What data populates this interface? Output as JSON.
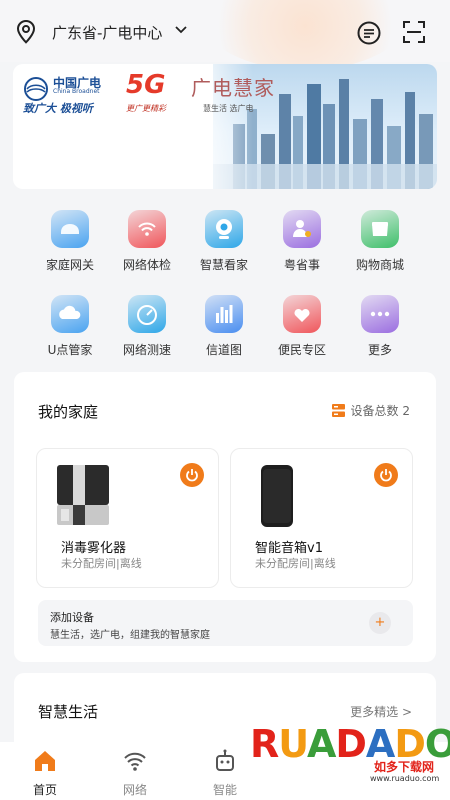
{
  "header": {
    "location": "广东省-广电中心",
    "icons": [
      "location-pin-icon",
      "chevron-down-icon",
      "message-icon",
      "scan-icon"
    ]
  },
  "banner": {
    "brand1_title": "中国广电",
    "brand1_sub": "China Broadnet",
    "brand1_slogan": "致广大 极视听",
    "brand2": "5G",
    "brand2_sub": "更广更精彩",
    "brand3": "广电慧家",
    "brand3_sub": "慧生活 选广电"
  },
  "services": [
    {
      "label": "家庭网关",
      "icon": "home-gateway-icon",
      "color": "#4aa3f0"
    },
    {
      "label": "网络体检",
      "icon": "network-check-icon",
      "color": "#f0565b"
    },
    {
      "label": "智慧看家",
      "icon": "camera-icon",
      "color": "#2fa7e8"
    },
    {
      "label": "粤省事",
      "icon": "person-icon",
      "color": "#9b6ee0"
    },
    {
      "label": "购物商城",
      "icon": "shop-icon",
      "color": "#3fbf6a"
    },
    {
      "label": "U点管家",
      "icon": "cloud-icon",
      "color": "#4aa3f0"
    },
    {
      "label": "网络测速",
      "icon": "speedometer-icon",
      "color": "#2fa7e8"
    },
    {
      "label": "信道图",
      "icon": "bar-chart-icon",
      "color": "#4a8ef0"
    },
    {
      "label": "便民专区",
      "icon": "heart-hand-icon",
      "color": "#f0565b"
    },
    {
      "label": "更多",
      "icon": "more-icon",
      "color": "#9b6ee0"
    }
  ],
  "family": {
    "title": "我的家庭",
    "device_count": "设备总数 2",
    "devices": [
      {
        "name": "消毒雾化器",
        "status": "未分配房间|离线"
      },
      {
        "name": "智能音箱v1",
        "status": "未分配房间|离线"
      }
    ],
    "add_title": "添加设备",
    "add_desc": "慧生活，选广电，组建我的智慧家庭",
    "add_symbol": "+"
  },
  "smart_life": {
    "title": "智慧生活",
    "more": "更多精选 >"
  },
  "tabs": [
    {
      "label": "首页",
      "icon": "home-icon",
      "active": true
    },
    {
      "label": "网络",
      "icon": "wifi-icon",
      "active": false
    },
    {
      "label": "智能",
      "icon": "robot-icon",
      "active": false
    }
  ],
  "watermark": {
    "text": "RUADADO",
    "cn": "如多下载网",
    "url": "www.ruaduo.com"
  },
  "colors": {
    "accent": "#f07b1a",
    "brand_blue": "#1c4f96"
  }
}
